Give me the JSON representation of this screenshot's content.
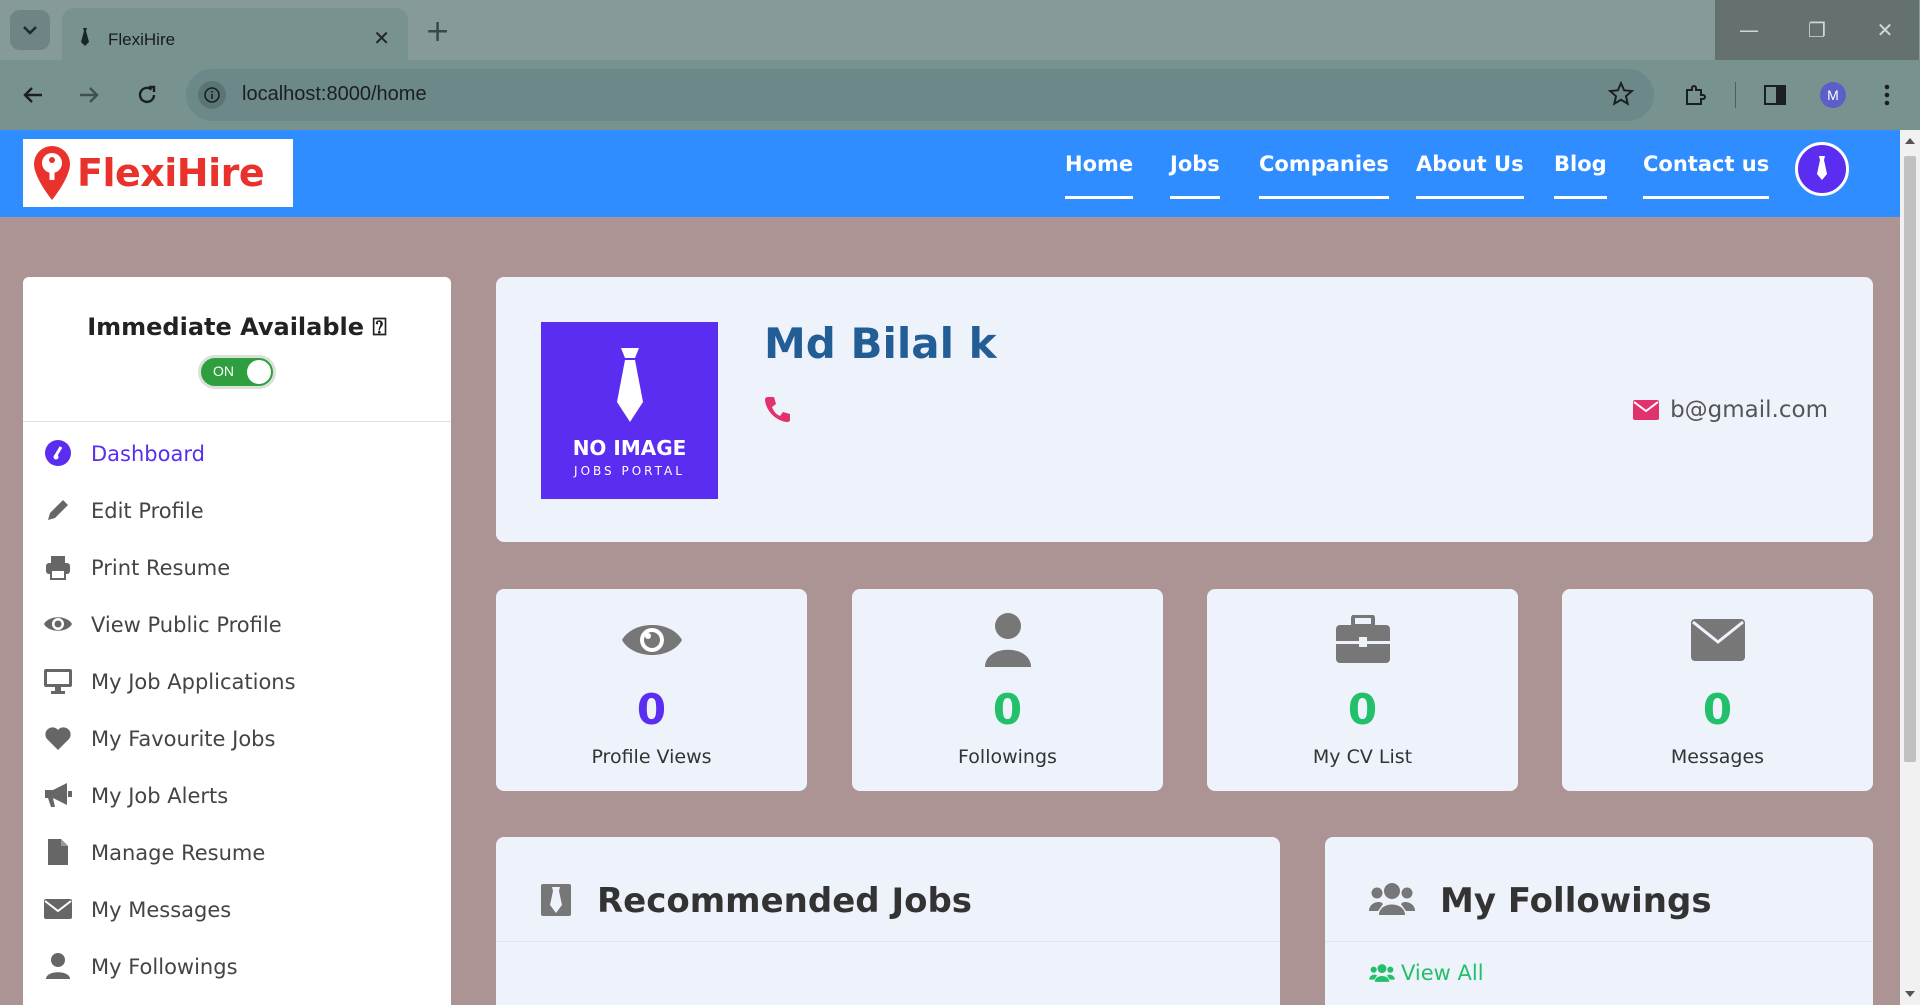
{
  "browser": {
    "tab_title": "FlexiHire",
    "new_tab": "+",
    "url": "localhost:8000/home",
    "profile_initial": "M"
  },
  "site": {
    "logo_text": "FlexiHire",
    "brand_color": "#2f8dff",
    "nav": [
      "Home",
      "Jobs",
      "Companies",
      "About Us",
      "Blog",
      "Contact us"
    ]
  },
  "sidebar": {
    "availability_title": "Immediate Available ⍰",
    "toggle_label": "ON",
    "items": [
      {
        "label": "Dashboard",
        "icon": "tachometer-icon",
        "active": true
      },
      {
        "label": "Edit Profile",
        "icon": "pencil-icon"
      },
      {
        "label": "Print Resume",
        "icon": "printer-icon"
      },
      {
        "label": "View Public Profile",
        "icon": "eye-icon"
      },
      {
        "label": "My Job Applications",
        "icon": "desktop-icon"
      },
      {
        "label": "My Favourite Jobs",
        "icon": "heart-icon"
      },
      {
        "label": "My Job Alerts",
        "icon": "bullhorn-icon"
      },
      {
        "label": "Manage Resume",
        "icon": "file-icon"
      },
      {
        "label": "My Messages",
        "icon": "envelope-icon"
      },
      {
        "label": "My Followings",
        "icon": "user-icon"
      }
    ]
  },
  "profile": {
    "name": "Md Bilal k",
    "email": "b@gmail.com",
    "no_image_line1": "NO IMAGE",
    "no_image_line2": "JOBS PORTAL"
  },
  "stats": [
    {
      "value": "0",
      "label": "Profile Views",
      "icon": "eye-icon",
      "color": "#5b2df0"
    },
    {
      "value": "0",
      "label": "Followings",
      "icon": "user-icon",
      "color": "#22c06a"
    },
    {
      "value": "0",
      "label": "My CV List",
      "icon": "briefcase-icon",
      "color": "#22c06a"
    },
    {
      "value": "0",
      "label": "Messages",
      "icon": "envelope-icon",
      "color": "#22c06a"
    }
  ],
  "sections": {
    "recommended_title": "Recommended Jobs",
    "followings_title": "My Followings",
    "view_all": "View All"
  }
}
